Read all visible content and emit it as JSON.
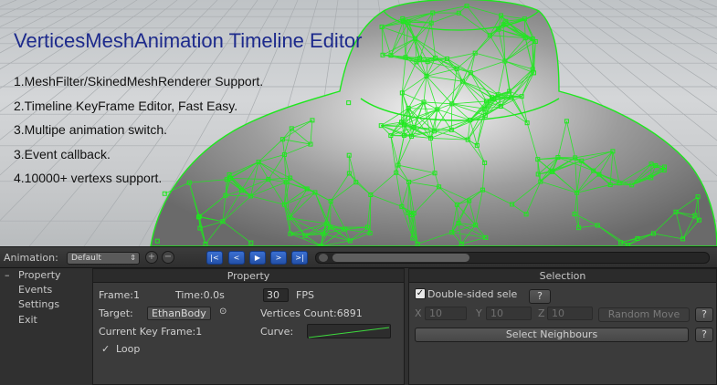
{
  "hero": {
    "title": "VerticesMeshAnimation Timeline Editor",
    "features": [
      "1.MeshFilter/SkinedMeshRenderer Support.",
      "2.Timeline KeyFrame Editor, Fast Easy.",
      "3.Multipe animation switch.",
      "3.Event callback.",
      "4.10000+ vertexs support."
    ],
    "wireframe_color": "#1ee81e"
  },
  "toolbar": {
    "animation_label": "Animation:",
    "animation_selected": "Default",
    "nav_buttons": [
      "|<",
      "<",
      "▶",
      ">",
      ">|"
    ],
    "accent_color": "#2f62c4"
  },
  "sidebar": {
    "items": [
      {
        "label": "Property",
        "selected": true
      },
      {
        "label": "Events",
        "selected": false
      },
      {
        "label": "Settings",
        "selected": false
      },
      {
        "label": "Exit",
        "selected": false
      }
    ],
    "indicator": "–"
  },
  "property_panel": {
    "header": "Property",
    "frame": "Frame:1",
    "time": "Time:0.0s",
    "fps_value": "30",
    "fps_label": "FPS",
    "target_label": "Target:",
    "target_value": "EthanBody",
    "target_icon": "⊙",
    "vertices_count": "Vertices Count:6891",
    "current_key_frame": "Current Key Frame:1",
    "curve_label": "Curve:",
    "loop_check": "✓",
    "loop_label": "Loop"
  },
  "selection_panel": {
    "header": "Selection",
    "double_sided_label": "Double-sided sele",
    "double_sided_checked": true,
    "help": "?",
    "x_label": "X",
    "x_value": "10",
    "y_label": "Y",
    "y_value": "10",
    "z_label": "Z",
    "z_value": "10",
    "random_move": "Random Move",
    "select_neighbours": "Select Neighbours"
  }
}
